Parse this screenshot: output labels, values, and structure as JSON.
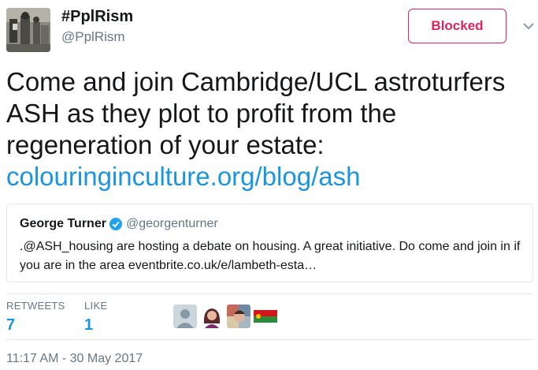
{
  "author": {
    "display_name": "#PplRism",
    "handle": "@PplRism",
    "avatar_icon": "profile-photo-icon"
  },
  "follow_button": {
    "label": "Blocked",
    "color": "#e0245e"
  },
  "menu": {
    "icon": "chevron-down-icon"
  },
  "tweet": {
    "text": "Come and join Cambridge/UCL astroturfers ASH as they plot to profit from the regeneration of your estate:",
    "link": "colouringinculture.org/blog/ash",
    "link_color": "#1b95e0"
  },
  "quoted_tweet": {
    "name": "George Turner",
    "verified_icon": "verified-badge-icon",
    "handle": "@georgenturner",
    "text": ".@ASH_housing are hosting a debate on housing. A great initiative. Do come and join in if you are in the area eventbrite.co.uk/e/lambeth-esta…"
  },
  "stats": {
    "retweets_label": "RETWEETS",
    "retweets_value": "7",
    "likes_label": "LIKE",
    "likes_value": "1"
  },
  "likers": [
    "default-avatar-icon",
    "woman-avatar-icon",
    "collage-avatar-icon",
    "flag-avatar-icon"
  ],
  "timestamp": "11:17 AM - 30 May 2017"
}
